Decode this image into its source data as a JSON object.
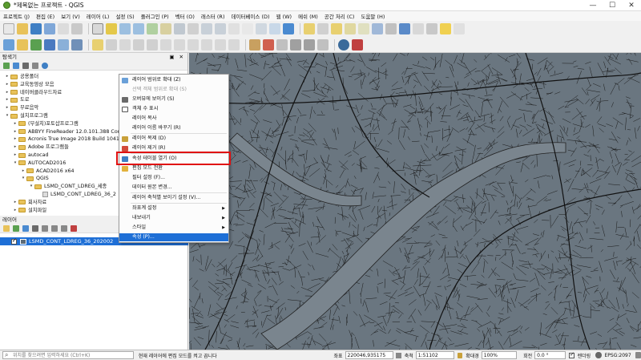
{
  "window": {
    "title": "*제목없는 프로젝트 - QGIS",
    "minimize": "—",
    "maximize": "☐",
    "close": "✕"
  },
  "menubar": [
    "프로젝트 (J)",
    "편집 (E)",
    "보기 (V)",
    "레이어 (L)",
    "설정 (S)",
    "플러그인 (P)",
    "벡터 (O)",
    "래스터 (R)",
    "데이터베이스 (D)",
    "웹 (W)",
    "메쉬 (M)",
    "공간 처리 (C)",
    "도움말 (H)"
  ],
  "browser": {
    "title": "탐색기",
    "header_buttons": "▣ ✕",
    "items": [
      {
        "label": "공용폴더",
        "type": "folder",
        "level": 1,
        "arrow": "▸"
      },
      {
        "label": "교육동영상 모음",
        "type": "folder",
        "level": 1,
        "arrow": "▸"
      },
      {
        "label": "네이버클라우드자료",
        "type": "folder",
        "level": 1,
        "arrow": "▸"
      },
      {
        "label": "도로",
        "type": "folder",
        "level": 1,
        "arrow": "▸"
      },
      {
        "label": "무료음악",
        "type": "folder",
        "level": 1,
        "arrow": "▸"
      },
      {
        "label": "설치프로그램",
        "type": "folder",
        "level": 1,
        "arrow": "▾"
      },
      {
        "label": "(무설치)포토샵프로그램",
        "type": "folder",
        "level": 2,
        "arrow": "▸"
      },
      {
        "label": "ABBYY FineReader 12.0.101.388 Corpo",
        "type": "folder",
        "level": 2,
        "arrow": "▸"
      },
      {
        "label": "Acronis True Image 2018 Build 10410",
        "type": "folder",
        "level": 2,
        "arrow": "▸"
      },
      {
        "label": "Adobe 프로그램들",
        "type": "folder",
        "level": 2,
        "arrow": "▸"
      },
      {
        "label": "autocad",
        "type": "folder",
        "level": 2,
        "arrow": "▸"
      },
      {
        "label": "AUTOCAD2016",
        "type": "folder",
        "level": 2,
        "arrow": "▾"
      },
      {
        "label": "ACAD2016 x64",
        "type": "folder",
        "level": 3,
        "arrow": "▸"
      },
      {
        "label": "QGIS",
        "type": "folder",
        "level": 3,
        "arrow": "▾"
      },
      {
        "label": "LSMD_CONT_LDREG_세종",
        "type": "folder",
        "level": 4,
        "arrow": "▾"
      },
      {
        "label": "LSMD_CONT_LDREG_36_2",
        "type": "file",
        "level": 5,
        "arrow": ""
      },
      {
        "label": "회사자료",
        "type": "folder",
        "level": 2,
        "arrow": "▸"
      },
      {
        "label": "설치파일",
        "type": "folder",
        "level": 2,
        "arrow": "▸"
      }
    ]
  },
  "layers": {
    "title": "레이어",
    "header_buttons": "▣ ✕",
    "active_layer": "LSMD_CONT_LDREG_36_202002"
  },
  "context_menu": {
    "items": [
      {
        "label": "레이어 범위로 확대 (Z)",
        "state": "normal",
        "icon_color": "#6aa0d8"
      },
      {
        "label": "선택 객체 범위로 확대 (S)",
        "state": "disabled",
        "icon_color": ""
      },
      {
        "label": "오버뷰에 보이기 (S)",
        "state": "normal",
        "icon_color": "#6a6a6a"
      },
      {
        "label": "객체 수 표시",
        "state": "normal",
        "icon_color": "#ffffff"
      },
      {
        "label": "레이어 복사",
        "state": "normal",
        "icon_color": ""
      },
      {
        "label": "레이어 이름 바꾸기 (R)",
        "state": "normal",
        "icon_color": ""
      },
      {
        "label": "레이어 복제 (D)",
        "state": "normal",
        "icon_color": "#c9a13a"
      },
      {
        "label": "레이어 제거 (R)",
        "state": "normal",
        "icon_color": "#d24a3a"
      },
      {
        "label": "속성 테이블 열기 (O)",
        "state": "normal",
        "icon_color": "#3f7fc4"
      },
      {
        "label": "편집 모드 전환",
        "state": "normal",
        "icon_color": "#e2b23c"
      },
      {
        "label": "필터 설정 (F)...",
        "state": "normal",
        "icon_color": ""
      },
      {
        "label": "데이터 원본 변경...",
        "state": "normal",
        "icon_color": ""
      },
      {
        "label": "레이어 축척별 보이기 설정 (V)...",
        "state": "normal",
        "icon_color": ""
      },
      {
        "label": "좌표계 설정",
        "state": "normal",
        "icon_color": "",
        "submenu": "▶"
      },
      {
        "label": "내보내기",
        "state": "normal",
        "icon_color": "",
        "submenu": "▶"
      },
      {
        "label": "스타일",
        "state": "normal",
        "icon_color": "",
        "submenu": "▶"
      },
      {
        "label": "속성 (P)...",
        "state": "active",
        "icon_color": ""
      }
    ]
  },
  "statusbar": {
    "search_placeholder": "위치를 찾으려면 입력하세요 (Ctrl+K)",
    "message": "현재 레이어에 편집 모드를 켜고 끕니다",
    "coord_label": "좌표",
    "coord_value": "220046,935175",
    "scale_label": "축척",
    "scale_value": "1:51102",
    "magnifier_label": "확대경",
    "magnifier_value": "100%",
    "rotation_label": "회전",
    "rotation_value": "0.0 °",
    "render_label": "렌더링",
    "crs": "EPSG:2097"
  },
  "colors": {
    "map_bg": "#6a7680",
    "map_lines": "#1a1a1a",
    "accent": "#1e6fd6",
    "highlight": "#e01010"
  }
}
